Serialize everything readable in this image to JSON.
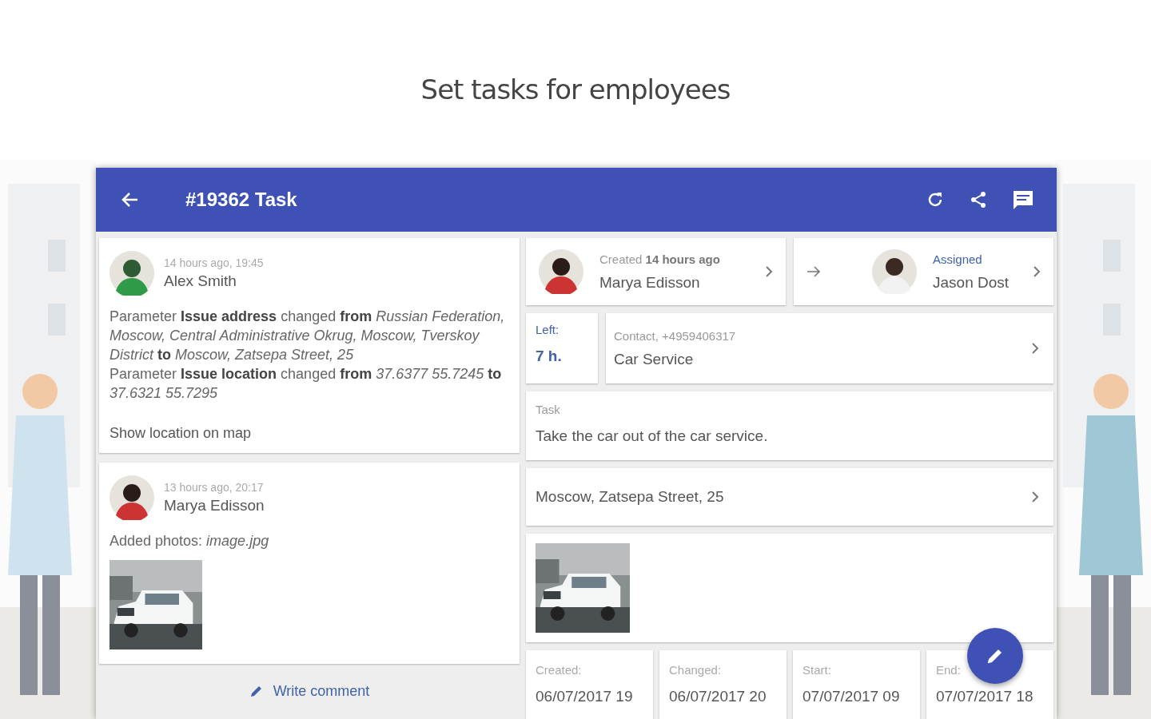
{
  "heading": "Set tasks for employees",
  "toolbar": {
    "title": "#19362 Task"
  },
  "comments": [
    {
      "time": "14 hours ago, 19:45",
      "author": "Alex Smith",
      "paragraphs": [
        "Parameter **Issue address** changed **from** *Russian Federation, Moscow, Central Administrative Okrug, Moscow, Tverskoy District* **to** *Moscow, Zatsepa Street, 25*",
        "Parameter **Issue location** changed **from** *37.6377 55.7245* **to** *37.6321 55.7295*"
      ],
      "link": "Show location on map"
    },
    {
      "time": "13 hours ago, 20:17",
      "author": "Marya Edisson",
      "paragraphs": [
        "Added photos:  *image.jpg*"
      ],
      "photos": [
        {
          "kind": "picture"
        }
      ]
    }
  ],
  "write_comment": "Write comment",
  "creator": {
    "caption": "Created **14 hours ago**",
    "name": "Marya Edisson"
  },
  "assignee": {
    "status": "Assigned",
    "name": "Jason Dost"
  },
  "deadline": {
    "label": "Left:",
    "value": "7 h."
  },
  "contact": {
    "caption": "Contact, +4959406317",
    "name": "Car Service"
  },
  "task": {
    "label": "Task",
    "text": "Take the car out of the car service."
  },
  "address": "Moscow, Zatsepa Street, 25",
  "attachments": [
    {
      "kind": "picture"
    }
  ],
  "dates": [
    {
      "label": "Created:",
      "value": "06/07/2017 19"
    },
    {
      "label": "Changed:",
      "value": "06/07/2017 20"
    },
    {
      "label": "Start:",
      "value": "07/07/2017 09"
    },
    {
      "label": "End:",
      "value": "07/07/2017 18"
    }
  ]
}
